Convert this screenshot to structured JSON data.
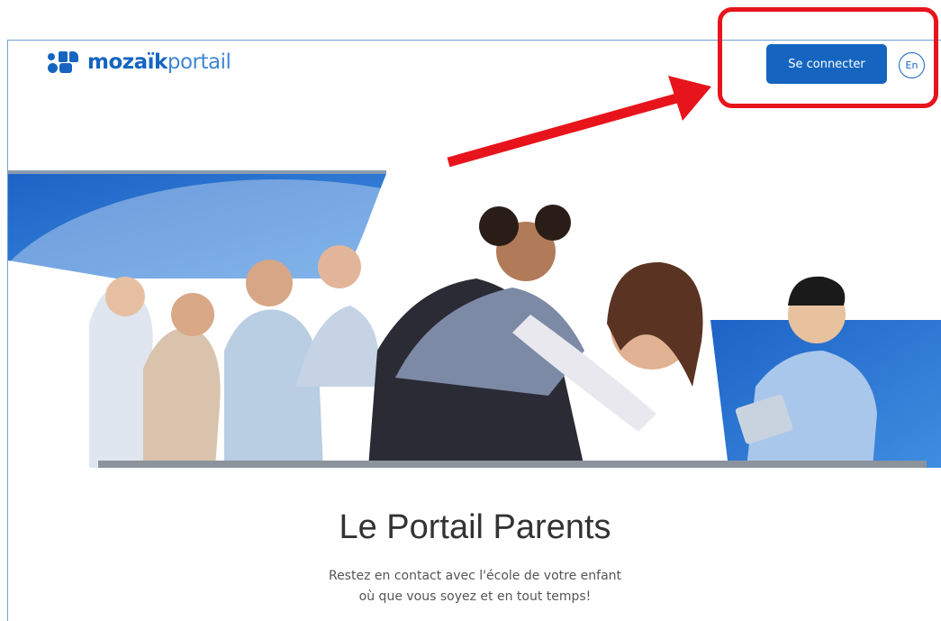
{
  "brand": {
    "name_bold": "mozaïk",
    "name_light": "portail",
    "color": "#1565c0"
  },
  "header": {
    "login_label": "Se connecter",
    "lang_label": "En"
  },
  "main": {
    "title": "Le Portail Parents",
    "subtitle_line1": "Restez en contact avec l'école de votre enfant",
    "subtitle_line2": "où que vous soyez et en tout temps!"
  },
  "annotation": {
    "highlight_color": "#e8141c"
  }
}
